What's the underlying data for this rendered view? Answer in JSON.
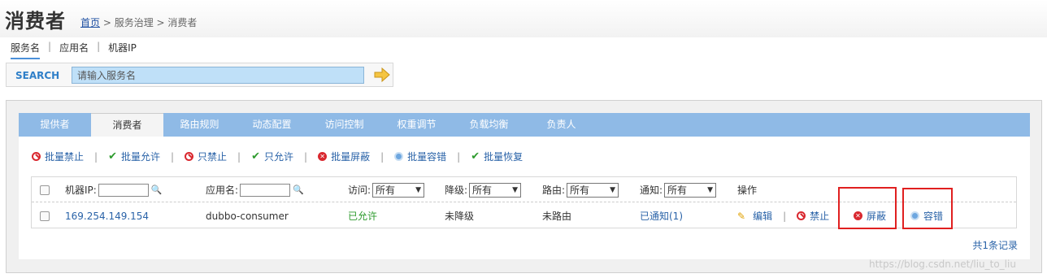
{
  "header": {
    "title": "消费者",
    "breadcrumb": {
      "home": "首页",
      "rest": " > 服务治理 > 消费者"
    }
  },
  "subtabs": [
    "服务名",
    "应用名",
    "机器IP"
  ],
  "search": {
    "label": "SEARCH",
    "placeholder": "请输入服务名"
  },
  "tabs": [
    "提供者",
    "消费者",
    "路由规则",
    "动态配置",
    "访问控制",
    "权重调节",
    "负载均衡",
    "负责人"
  ],
  "actions": [
    "批量禁止",
    "批量允许",
    "只禁止",
    "只允许",
    "批量屏蔽",
    "批量容错",
    "批量恢复"
  ],
  "table": {
    "headers": {
      "ip": "机器IP:",
      "app": "应用名:",
      "access": "访问:",
      "degrade": "降级:",
      "route": "路由:",
      "notify": "通知:",
      "ops": "操作",
      "select_value": "所有"
    },
    "row": {
      "ip": "169.254.149.154",
      "app": "dubbo-consumer",
      "access": "已允许",
      "degrade": "未降级",
      "route": "未路由",
      "notify": "已通知(1)",
      "edit": "编辑",
      "forbid": "禁止",
      "shield": "屏蔽",
      "tolerance": "容错"
    }
  },
  "footer": {
    "count": "共1条记录"
  },
  "watermark": "https://blog.csdn.net/liu_to_liu"
}
